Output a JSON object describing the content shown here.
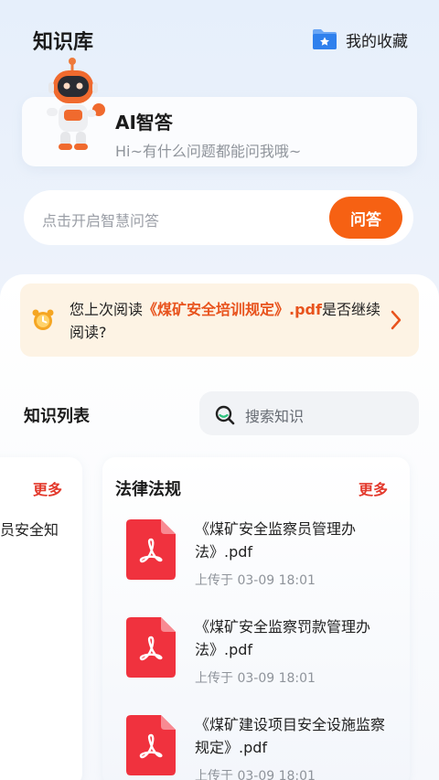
{
  "header": {
    "title": "知识库",
    "favorites_label": "我的收藏"
  },
  "assistant": {
    "title": "AI智答",
    "subtitle": "Hi~有什么问题都能问我哦~"
  },
  "ask_bar": {
    "placeholder": "点击开启智慧问答",
    "button_label": "问答"
  },
  "resume": {
    "prefix": "您上次阅读",
    "file": "《煤矿安全培训规定》.pdf",
    "suffix": "是否继续阅读?"
  },
  "knowledge": {
    "title": "知识列表",
    "search_placeholder": "搜索知识"
  },
  "card_left": {
    "more_label": "更多",
    "partial_text": "员安全知"
  },
  "card_main": {
    "title": "法律法规",
    "more_label": "更多",
    "items": [
      {
        "name": "《煤矿安全监察员管理办法》.pdf",
        "meta": "上传于 03-09 18:01"
      },
      {
        "name": "《煤矿安全监察罚款管理办法》.pdf",
        "meta": "上传于 03-09 18:01"
      },
      {
        "name": "《煤矿建设项目安全设施监察规定》.pdf",
        "meta": "上传于 03-09 18:01"
      }
    ]
  },
  "colors": {
    "accent": "#f66113",
    "more": "#e3392c",
    "pdf": "#f0323e",
    "highlight": "#e8531d"
  }
}
